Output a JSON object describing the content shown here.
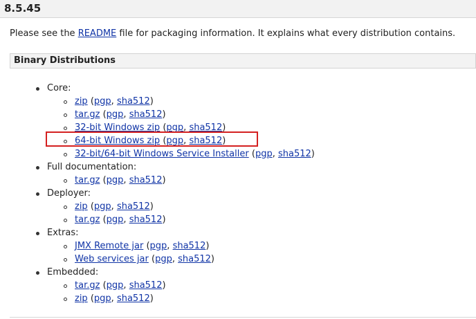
{
  "version": "8.5.45",
  "intro": {
    "before": "Please see the ",
    "link": "README",
    "after": " file for packaging information. It explains what every distribution contains."
  },
  "section_title": "Binary Distributions",
  "groups": [
    {
      "label": "Core:",
      "items": [
        {
          "main": "zip",
          "pgp": "pgp",
          "sha": "sha512"
        },
        {
          "main": "tar.gz",
          "pgp": "pgp",
          "sha": "sha512"
        },
        {
          "main": "32-bit Windows zip",
          "pgp": "pgp",
          "sha": "sha512"
        },
        {
          "main": "64-bit Windows zip",
          "pgp": "pgp",
          "sha": "sha512"
        },
        {
          "main": "32-bit/64-bit Windows Service Installer",
          "pgp": "pgp",
          "sha": "sha512"
        }
      ]
    },
    {
      "label": "Full documentation:",
      "items": [
        {
          "main": "tar.gz",
          "pgp": "pgp",
          "sha": "sha512"
        }
      ]
    },
    {
      "label": "Deployer:",
      "items": [
        {
          "main": "zip",
          "pgp": "pgp",
          "sha": "sha512"
        },
        {
          "main": "tar.gz",
          "pgp": "pgp",
          "sha": "sha512"
        }
      ]
    },
    {
      "label": "Extras:",
      "items": [
        {
          "main": "JMX Remote jar",
          "pgp": "pgp",
          "sha": "sha512"
        },
        {
          "main": "Web services jar",
          "pgp": "pgp",
          "sha": "sha512"
        }
      ]
    },
    {
      "label": "Embedded:",
      "items": [
        {
          "main": "tar.gz",
          "pgp": "pgp",
          "sha": "sha512"
        },
        {
          "main": "zip",
          "pgp": "pgp",
          "sha": "sha512"
        }
      ]
    }
  ],
  "punct": {
    "open": " (",
    "comma": ", ",
    "close": ")"
  },
  "colors": {
    "link": "#1034a6",
    "highlight": "#d42020"
  }
}
